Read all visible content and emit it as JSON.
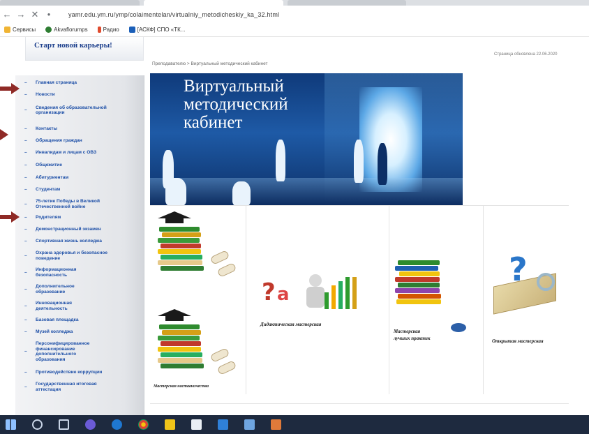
{
  "browser": {
    "url": "yamr.edu.ym.ru/ymp/colaimentelan/virtualniy_metodicheskiy_ka_32.html",
    "bookmarks": [
      {
        "label": "Сервисы",
        "color": "#f0b433"
      },
      {
        "label": "Akvaflorumps",
        "color": "#2e7d32"
      },
      {
        "label": "Радио",
        "color": "#e04b2e"
      },
      {
        "label": "[АСКФ] СПО «ТК...",
        "color": "#1b5fb8"
      }
    ]
  },
  "page": {
    "career_banner": "Старт новой карьеры!",
    "breadcrumb": "Преподавателю > Виртуальный методический кабинет",
    "updated": "Страница обновлена 22.06.2020",
    "banner_title_1": "Виртуальный",
    "banner_title_2": "методический",
    "banner_title_3": "кабинет"
  },
  "sidebar": {
    "items": [
      {
        "label": "Главная страница"
      },
      {
        "label": "Новости"
      },
      {
        "label": "Сведения об образовательной организации"
      },
      {
        "label": "Контакты"
      },
      {
        "label": "Обращения граждан"
      },
      {
        "label": "Инвалидам и лицам с ОВЗ"
      },
      {
        "label": "Общежитие"
      },
      {
        "label": "Абитуриентам"
      },
      {
        "label": "Студентам"
      },
      {
        "label": "75-летие Победы в Великой Отечественной войне"
      },
      {
        "label": "Родителям"
      },
      {
        "label": "Демонстрационный экзамен"
      },
      {
        "label": "Спортивная жизнь колледжа"
      },
      {
        "label": "Охрана здоровья и безопасное поведение"
      },
      {
        "label": "Информационная безопасность"
      },
      {
        "label": "Дополнительное образование"
      },
      {
        "label": "Инновационная деятельность"
      },
      {
        "label": "Базовая площадка"
      },
      {
        "label": "Музей колледжа"
      },
      {
        "label": "Персонифицированное финансирование дополнительного образования"
      },
      {
        "label": "Противодействие коррупции"
      },
      {
        "label": "Государственная итоговая аттестация"
      }
    ]
  },
  "tiles": {
    "didactic": "Дидактическая мастерская",
    "practice_line1": "Мастерская",
    "practice_line2": "лучших практик",
    "open": "Открытая мастерская",
    "mastery": "Мастерская наставничества"
  },
  "colors": {
    "menu_link": "#1d4fa7",
    "annotation_arrow": "#8f2a26",
    "banner_blue": "#1e5aa6",
    "taskbar": "#1e2a3f"
  }
}
